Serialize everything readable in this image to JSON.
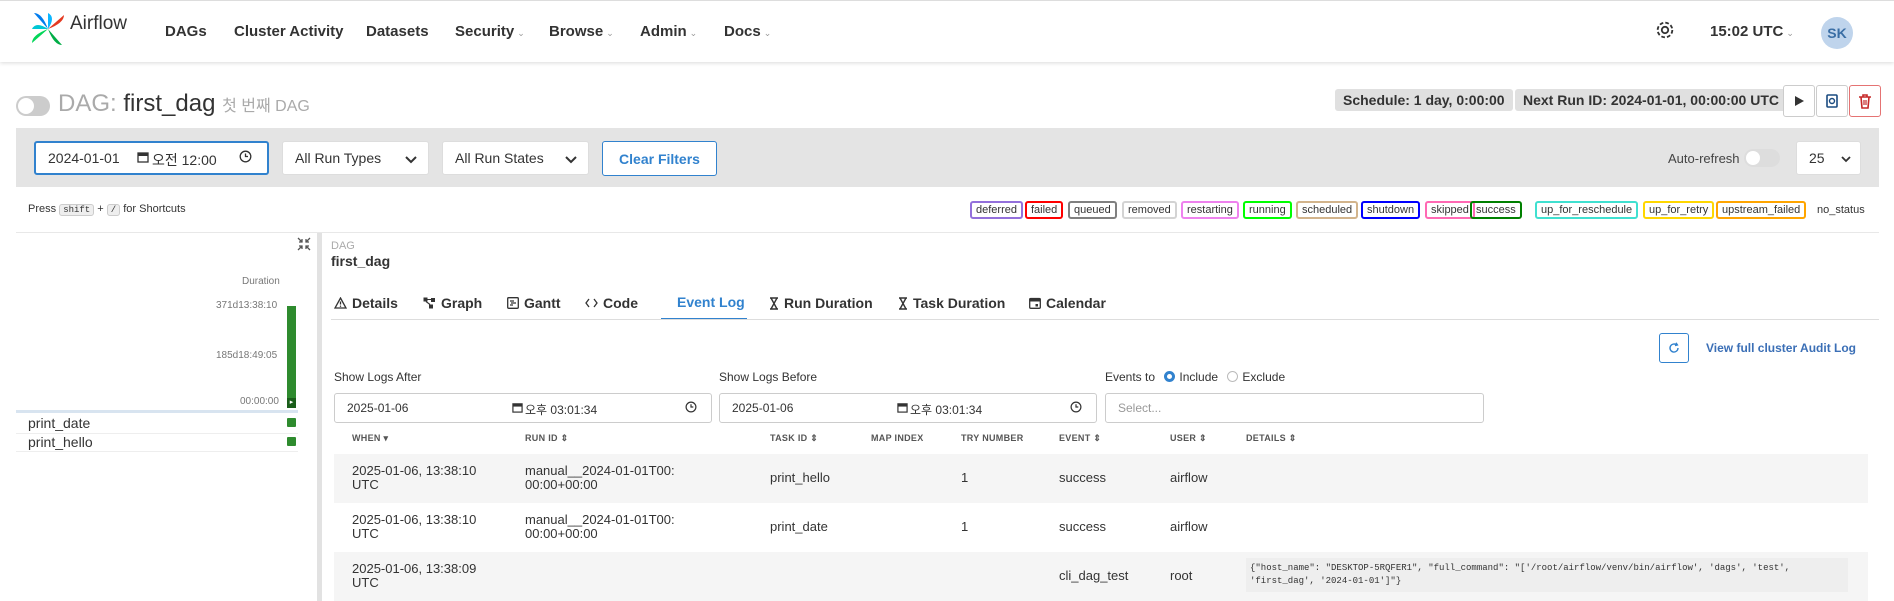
{
  "brand": "Airflow",
  "nav": [
    {
      "label": "DAGs",
      "dropdown": false
    },
    {
      "label": "Cluster Activity",
      "dropdown": false
    },
    {
      "label": "Datasets",
      "dropdown": false
    },
    {
      "label": "Security",
      "dropdown": true
    },
    {
      "label": "Browse",
      "dropdown": true
    },
    {
      "label": "Admin",
      "dropdown": true
    },
    {
      "label": "Docs",
      "dropdown": true
    }
  ],
  "time": "15:02 UTC",
  "avatar": "SK",
  "dag": {
    "label": "DAG:",
    "name": "first_dag",
    "description": "첫 번째 DAG",
    "schedule": "Schedule: 1 day, 0:00:00",
    "next_run": "Next Run ID: 2024-01-01, 00:00:00 UTC"
  },
  "filters": {
    "date": "2024-01-01",
    "time": "오전 12:00",
    "run_types": "All Run Types",
    "run_states": "All Run States",
    "clear_label": "Clear Filters",
    "auto_refresh": "Auto-refresh",
    "page_size": "25"
  },
  "shortcuts": {
    "press": "Press",
    "key1": "shift",
    "plus": "+",
    "key2": "/",
    "suffix": "for Shortcuts"
  },
  "legend": [
    {
      "label": "deferred",
      "color": "#9370db"
    },
    {
      "label": "failed",
      "color": "#ff0000"
    },
    {
      "label": "queued",
      "color": "#808080"
    },
    {
      "label": "removed",
      "color": "#d3d3d3"
    },
    {
      "label": "restarting",
      "color": "#ee82ee"
    },
    {
      "label": "running",
      "color": "#00ff00"
    },
    {
      "label": "scheduled",
      "color": "#d2b48c"
    },
    {
      "label": "shutdown",
      "color": "#0000ff"
    },
    {
      "label": "skipped",
      "color": "#ff69b4"
    },
    {
      "label": "success",
      "color": "#008000"
    },
    {
      "label": "up_for_reschedule",
      "color": "#40e0d0"
    },
    {
      "label": "up_for_retry",
      "color": "#ffd700"
    },
    {
      "label": "upstream_failed",
      "color": "#ffa500"
    },
    {
      "label": "no_status",
      "color": "#ffffff"
    }
  ],
  "grid": {
    "duration_label": "Duration",
    "ticks": [
      "371d13:38:10",
      "185d18:49:05",
      "00:00:00"
    ],
    "tasks": [
      "print_date",
      "print_hello"
    ]
  },
  "panel": {
    "crumb_label": "DAG",
    "crumb_name": "first_dag",
    "tabs": [
      {
        "label": "Details",
        "icon": "warning-icon"
      },
      {
        "label": "Graph",
        "icon": "graph-icon"
      },
      {
        "label": "Gantt",
        "icon": "gantt-icon"
      },
      {
        "label": "Code",
        "icon": "code-icon"
      },
      {
        "label": "Event Log",
        "icon": "list-icon",
        "active": true
      },
      {
        "label": "Run Duration",
        "icon": "hourglass-icon"
      },
      {
        "label": "Task Duration",
        "icon": "hourglass-icon"
      },
      {
        "label": "Calendar",
        "icon": "calendar-icon"
      }
    ],
    "audit_link": "View full cluster Audit Log",
    "logs_after_label": "Show Logs After",
    "logs_after_date": "2025-01-06",
    "logs_after_time": "오후 03:01:34",
    "logs_before_label": "Show Logs Before",
    "logs_before_date": "2025-01-06",
    "logs_before_time": "오후 03:01:34",
    "events_to": "Events to",
    "include": "Include",
    "exclude": "Exclude",
    "select_placeholder": "Select..."
  },
  "table": {
    "headers": [
      "WHEN",
      "RUN ID",
      "TASK ID",
      "MAP INDEX",
      "TRY NUMBER",
      "EVENT",
      "USER",
      "DETAILS"
    ],
    "rows": [
      {
        "when": "2025-01-06, 13:38:10 UTC",
        "run_id": "manual__2024-01-01T00:00:00+00:00",
        "task_id": "print_hello",
        "map_index": "",
        "try": "1",
        "event": "success",
        "user": "airflow",
        "details": ""
      },
      {
        "when": "2025-01-06, 13:38:10 UTC",
        "run_id": "manual__2024-01-01T00:00:00+00:00",
        "task_id": "print_date",
        "map_index": "",
        "try": "1",
        "event": "success",
        "user": "airflow",
        "details": ""
      },
      {
        "when": "2025-01-06, 13:38:09 UTC",
        "run_id": "",
        "task_id": "",
        "map_index": "",
        "try": "",
        "event": "cli_dag_test",
        "user": "root",
        "details": "{\"host_name\": \"DESKTOP-5RQFER1\", \"full_command\": \"['/root/airflow/venv/bin/airflow', 'dags', 'test', 'first_dag', '2024-01-01']\"}"
      }
    ]
  }
}
